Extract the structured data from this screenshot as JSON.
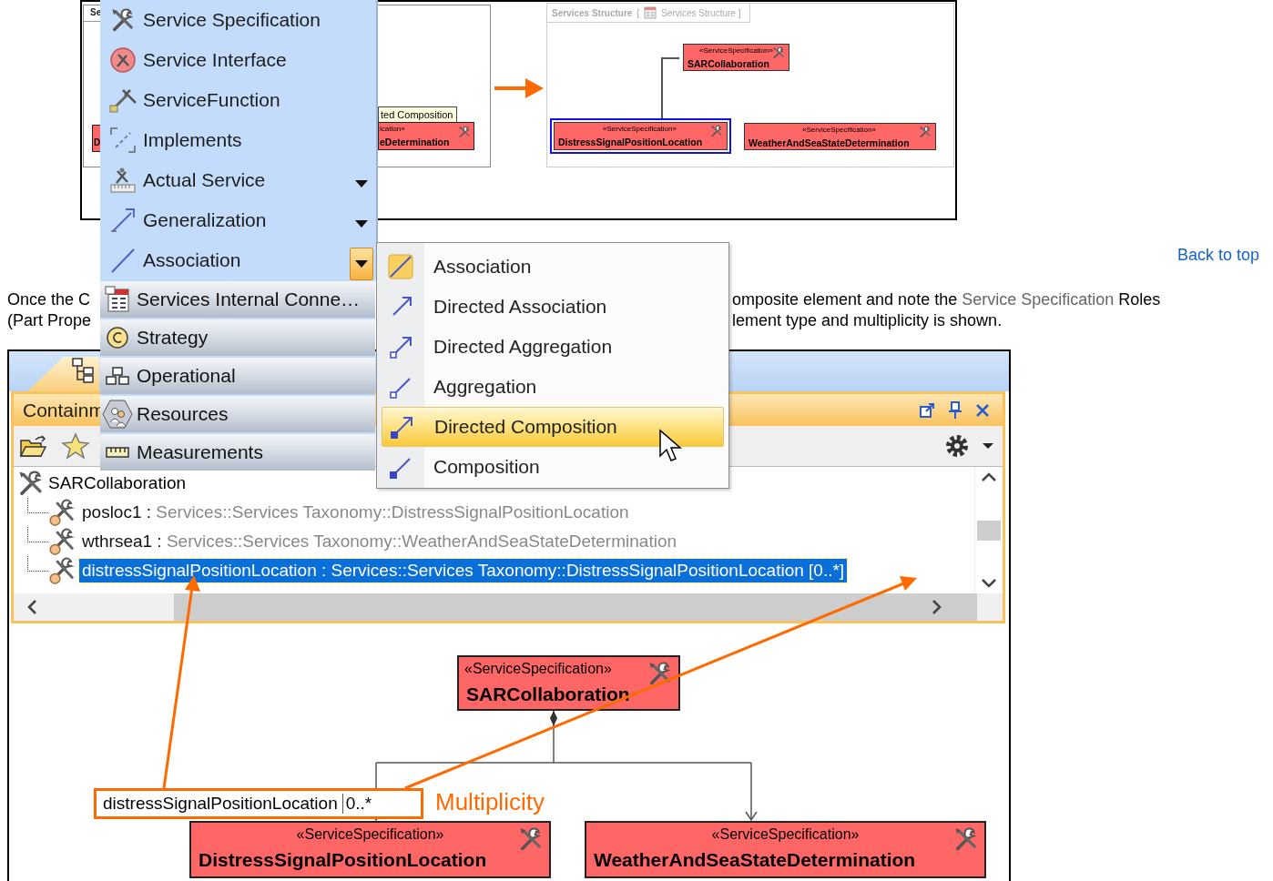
{
  "top_screenshot": {
    "left_diagram": {
      "frame_tab": "Se",
      "left_block": {
        "name": "D"
      },
      "tooltip": "ted Composition",
      "right_block": {
        "stereotype": "ication»",
        "name": "eDetermination"
      }
    },
    "right_diagram": {
      "frame_title": "Services Structure",
      "bracket_open": "[",
      "diagram_name": "Services Structure ]",
      "blocks": [
        {
          "stereotype": "«ServiceSpecification»",
          "name": "SARCollaboration",
          "selected": false
        },
        {
          "stereotype": "«ServiceSpecification»",
          "name": "DistressSignalPositionLocation",
          "selected": true
        },
        {
          "stereotype": "«ServiceSpecification»",
          "name": "WeatherAndSeaStateDetermination",
          "selected": false
        }
      ]
    }
  },
  "palette": {
    "items": [
      {
        "label": "Service Specification",
        "submenu_arrow": false,
        "expanded": false
      },
      {
        "label": "Service Interface",
        "submenu_arrow": false,
        "expanded": false
      },
      {
        "label": "ServiceFunction",
        "submenu_arrow": false,
        "expanded": false
      },
      {
        "label": "Implements",
        "submenu_arrow": false,
        "expanded": false
      },
      {
        "label": "Actual Service",
        "submenu_arrow": true,
        "expanded": false
      },
      {
        "label": "Generalization",
        "submenu_arrow": true,
        "expanded": false
      },
      {
        "label": "Association",
        "submenu_arrow": true,
        "expanded": true
      }
    ],
    "groups": [
      "Services Internal Conne…",
      "Strategy",
      "Operational",
      "Resources",
      "Measurements"
    ]
  },
  "submenu": {
    "items": [
      {
        "label": "Association",
        "selected": false
      },
      {
        "label": "Directed Association",
        "selected": false
      },
      {
        "label": "Directed Aggregation",
        "selected": false
      },
      {
        "label": "Aggregation",
        "selected": false
      },
      {
        "label": "Directed Composition",
        "selected": true
      },
      {
        "label": "Composition",
        "selected": false
      }
    ]
  },
  "back_to_top": "Back to top",
  "paragraph": {
    "line_1_start": "Once the C",
    "line_1_end_before": "omposite element and note the ",
    "line_1_link": "Service Specification",
    "line_1_end_after": " Roles",
    "line_2_start": "(Part Prope",
    "line_2_end": "lement type and multiplicity is shown."
  },
  "containment_screenshot": {
    "panel_title": "Containm",
    "tree": {
      "label": "SARCollaboration",
      "children": [
        {
          "name": "posloc1 :",
          "type": "Services::Services Taxonomy::DistressSignalPositionLocation",
          "selected": false
        },
        {
          "name": "wthrsea1 :",
          "type": "Services::Services Taxonomy::WeatherAndSeaStateDetermination",
          "selected": false
        },
        {
          "name": "distressSignalPositionLocation :",
          "type": "Services::Services Taxonomy::DistressSignalPositionLocation [0..*]",
          "selected": true
        }
      ]
    },
    "diagram": {
      "blocks": [
        {
          "stereotype": "«ServiceSpecification»",
          "name": "SARCollaboration"
        },
        {
          "stereotype": "«ServiceSpecification»",
          "name": "DistressSignalPositionLocation"
        },
        {
          "stereotype": "«ServiceSpecification»",
          "name": "WeatherAndSeaStateDetermination"
        }
      ],
      "role_label": {
        "role": "distressSignalPositionLocation",
        "multiplicity": "0..*"
      },
      "annotation": "Multiplicity"
    }
  }
}
